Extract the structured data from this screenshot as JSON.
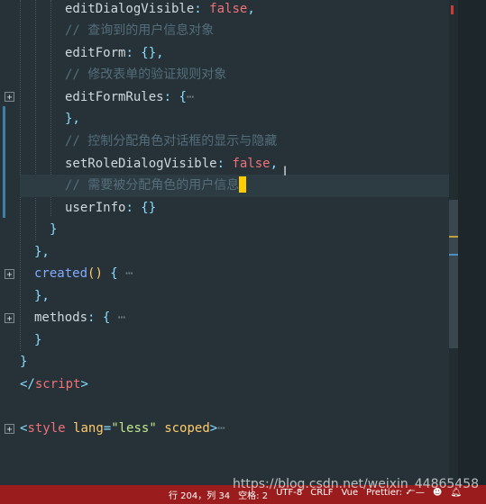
{
  "editor": {
    "lines": [
      {
        "key": "editDialogVisible",
        "sep": ": ",
        "bool": "false",
        "end": ","
      },
      {
        "comment": "// 查询到的用户信息对象"
      },
      {
        "key": "editForm",
        "sep": ": ",
        "val": "{},"
      },
      {
        "comment": "// 修改表单的验证规则对象"
      },
      {
        "key": "editFormRules",
        "sep": ": ",
        "val": "{",
        "ell": "⋯"
      },
      {
        "text": "},"
      },
      {
        "comment": "// 控制分配角色对话框的显示与隐藏"
      },
      {
        "key": "setRoleDialogVisible",
        "sep": ": ",
        "bool": "false",
        "end": ","
      },
      {
        "comment": "// 需要被分配角色的用户信息"
      },
      {
        "key": "userInfo",
        "sep": ": ",
        "val": "{}"
      },
      {
        "text": "}"
      },
      {
        "text": "},"
      },
      {
        "method": "created",
        "paren": "()",
        "val": " {",
        "ell": " ⋯"
      },
      {
        "text": "},"
      },
      {
        "key": "methods",
        "sep": ": ",
        "val": "{",
        "ell": " ⋯"
      },
      {
        "text": "}"
      },
      {
        "text": "}"
      },
      {
        "tag_open": "</",
        "tag": "script",
        "tag_close": ">"
      },
      {
        "text": ""
      },
      {
        "tag_open": "<",
        "tag": "style",
        "attr1": "lang",
        "eq": "=",
        "str1": "\"less\"",
        "attr2": "scoped",
        "tag_close": ">",
        "ell": "⋯"
      }
    ]
  },
  "statusbar": {
    "position": "行 204，列 34",
    "spaces": "空格: 2",
    "encoding": "UTF-8",
    "eol": "CRLF",
    "language": "Vue",
    "prettier": "Prettier: ✓ —",
    "smiley_icon": "smiley-icon",
    "bell_icon": "bell-icon"
  },
  "watermark": "https://blog.csdn.net/weixin_44865458",
  "colors": {
    "background": "#263238",
    "status": "#9b1c1c",
    "cursor": "#ffcc00"
  }
}
